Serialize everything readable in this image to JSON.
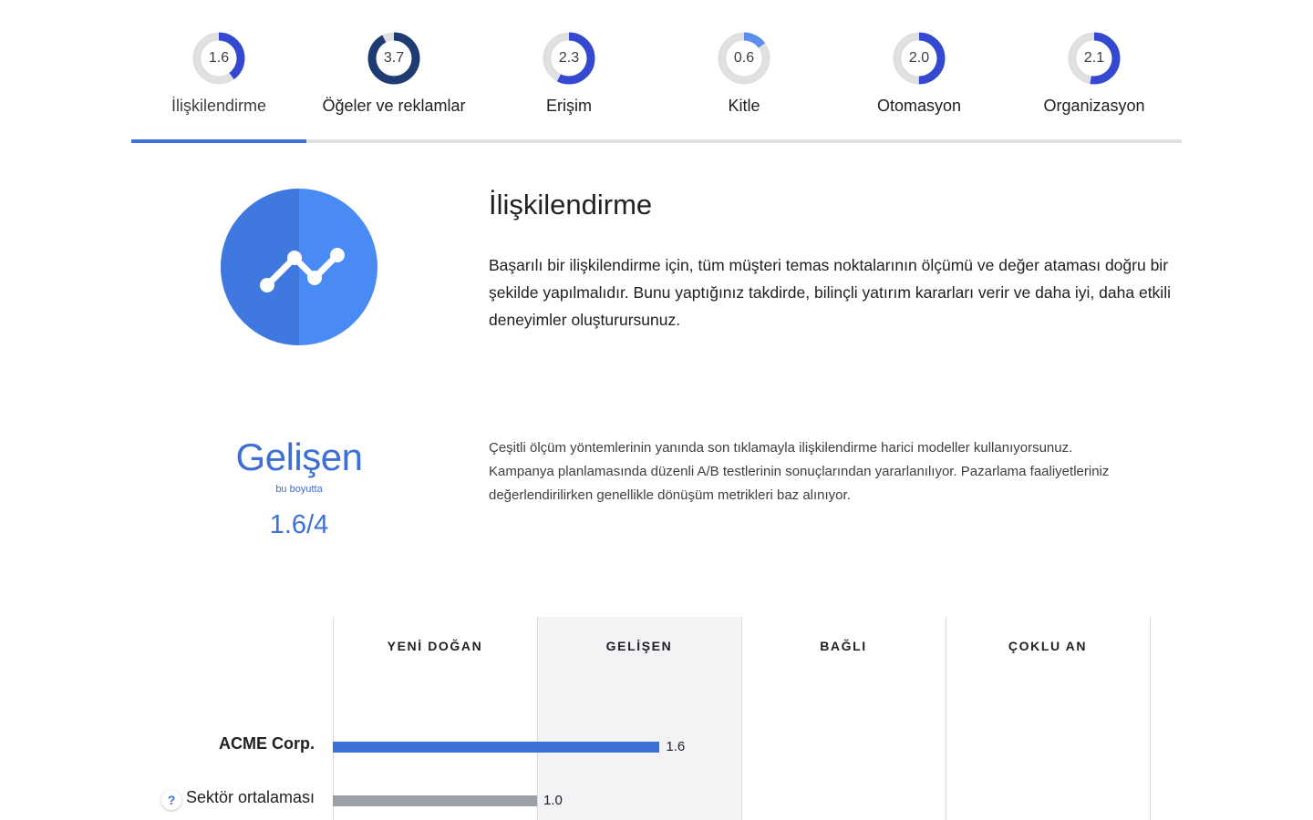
{
  "colors": {
    "accent": "#3d6fd6",
    "icon_dark": "#3f78de",
    "icon_light": "#4a8af4",
    "gauge_track": "#e0e0e0",
    "gauge_fill": "#3549d0",
    "gauge_dark": "#1f3b73",
    "gauge_light": "#5b8ef0",
    "bar_gray": "#9aa0a6",
    "active_column_bg": "#f1f3f4"
  },
  "tabs": [
    {
      "label": "İlişkilendirme",
      "score": "1.6",
      "fraction": 0.4,
      "style": "blue",
      "active": true
    },
    {
      "label": "Öğeler ve reklamlar",
      "score": "3.7",
      "fraction": 0.925,
      "style": "dark",
      "active": false
    },
    {
      "label": "Erişim",
      "score": "2.3",
      "fraction": 0.575,
      "style": "blue",
      "active": false
    },
    {
      "label": "Kitle",
      "score": "0.6",
      "fraction": 0.15,
      "style": "light",
      "active": false
    },
    {
      "label": "Otomasyon",
      "score": "2.0",
      "fraction": 0.5,
      "style": "blue",
      "active": false
    },
    {
      "label": "Organizasyon",
      "score": "2.1",
      "fraction": 0.525,
      "style": "blue",
      "active": false
    }
  ],
  "intro": {
    "icon": "trend-line-icon",
    "title": "İlişkilendirme",
    "text": "Başarılı bir ilişkilendirme için, tüm müşteri temas noktalarının ölçümü ve değer ataması doğru bir şekilde yapılmalıdır. Bunu yaptığınız takdirde, bilinçli yatırım kararları verir ve daha iyi, daha etkili deneyimler oluşturursunuz."
  },
  "score": {
    "stage": "Gelişen",
    "subtitle": "bu boyutta",
    "value": "1.6/4",
    "description": "Çeşitli ölçüm yöntemlerinin yanında son tıklamayla ilişkilendirme harici modeller kullanıyorsunuz. Kampanya planlamasında düzenli A/B testlerinin sonuçlarından yararlanılıyor. Pazarlama faaliyetleriniz değerlendirilirken genellikle dönüşüm metrikleri baz alınıyor."
  },
  "benchmark": {
    "columns": [
      "YENİ DOĞAN",
      "GELİŞEN",
      "BAĞLI",
      "ÇOKLU AN"
    ],
    "active_column": 1,
    "scale_max": 4,
    "rows": [
      {
        "label": "ACME Corp.",
        "value": 1.6,
        "value_label": "1.6",
        "color": "#3d6fd6",
        "bold": true,
        "help": false
      },
      {
        "label": "Sektör ortalaması",
        "value": 1.0,
        "value_label": "1.0",
        "color": "#9aa0a6",
        "bold": false,
        "help": true
      }
    ],
    "help_icon": "question-mark-icon",
    "help_symbol": "?"
  }
}
